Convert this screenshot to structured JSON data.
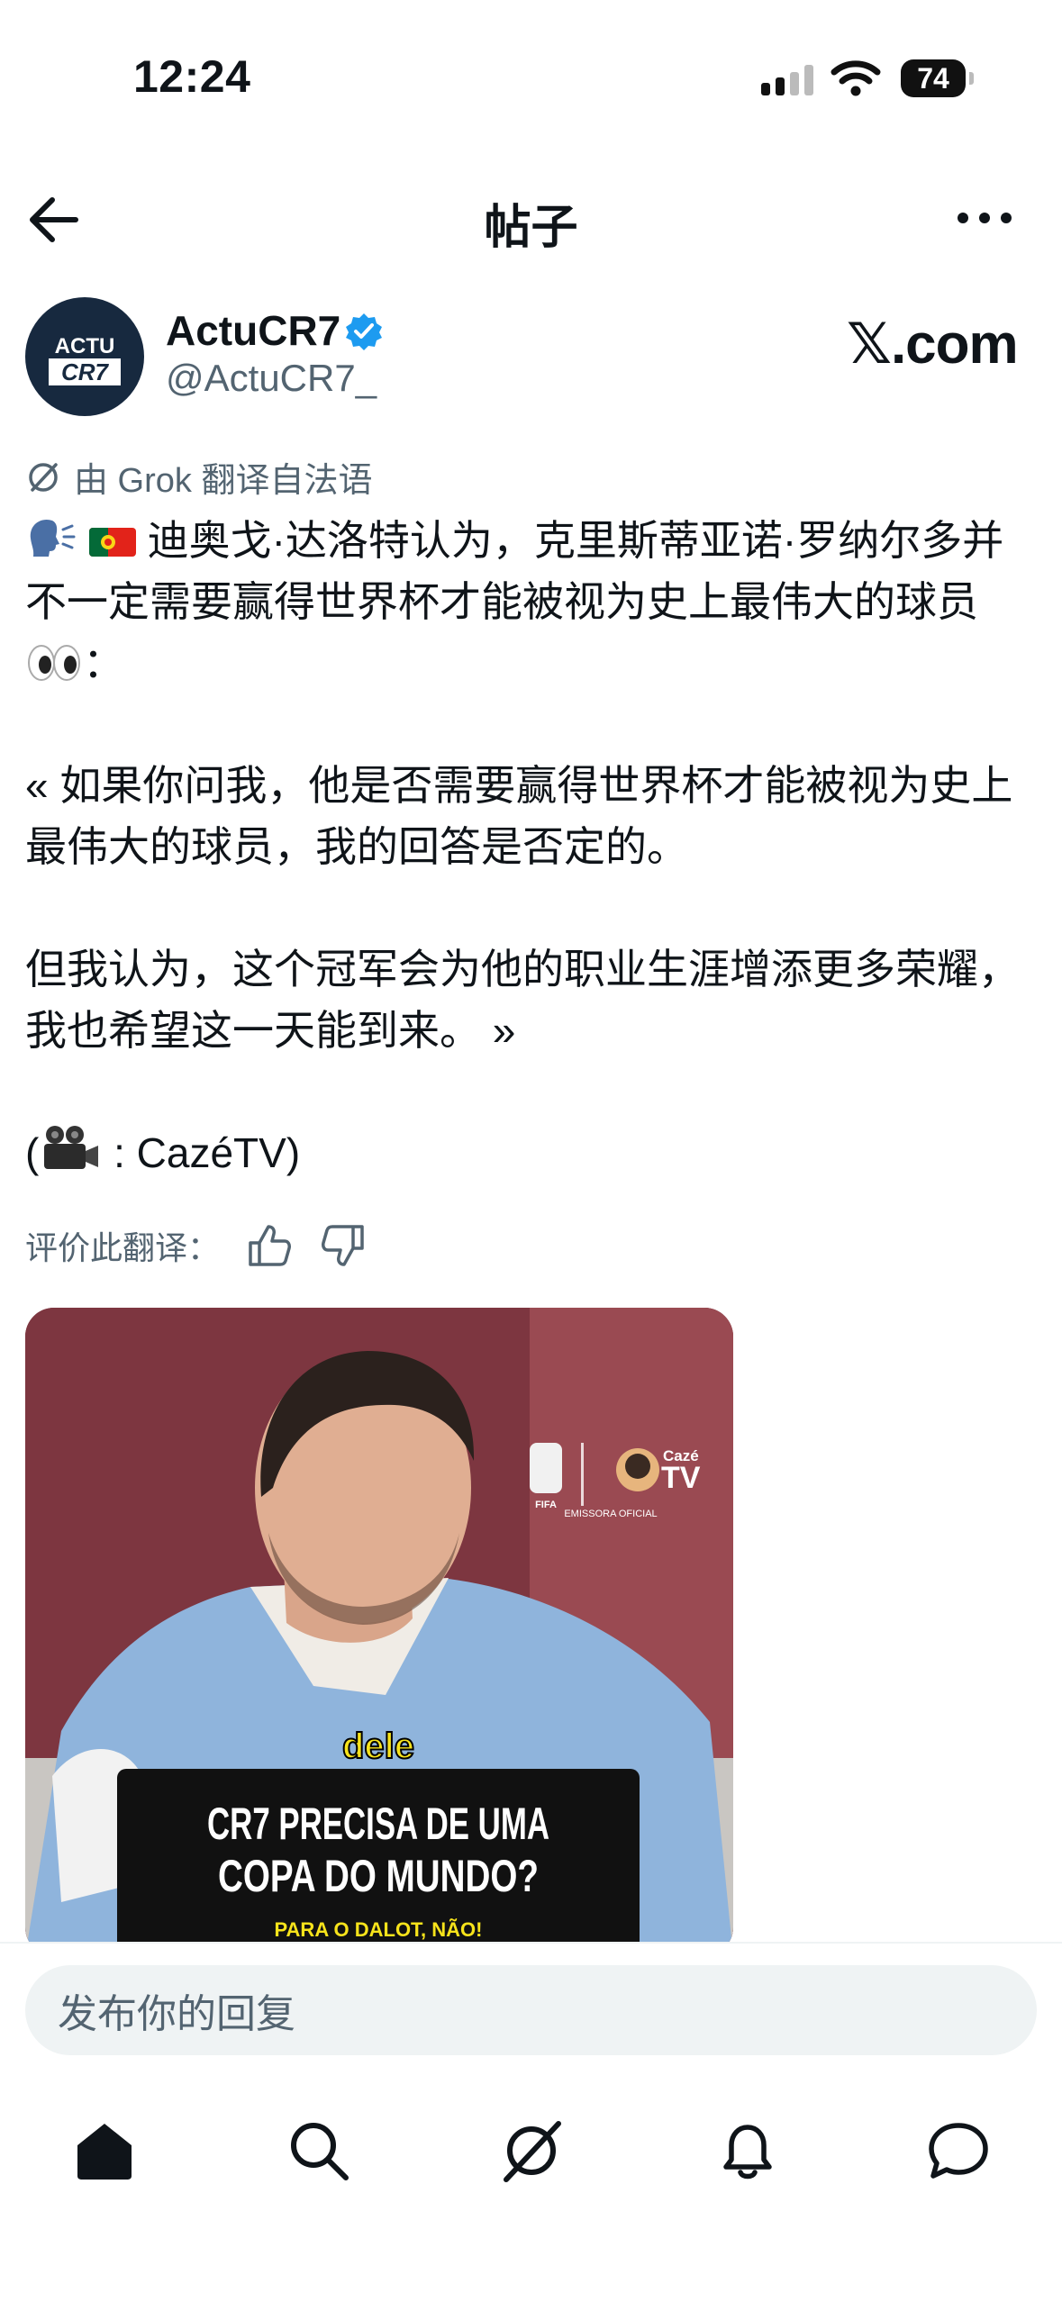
{
  "status": {
    "time": "12:24",
    "battery": "74"
  },
  "header": {
    "title": "帖子"
  },
  "author": {
    "name": "ActuCR7",
    "handle": "@ActuCR7_",
    "avatar_text_top": "ACTU",
    "avatar_text_bottom": "CR7"
  },
  "watermark": "𝕏.com",
  "translation_note": "由 Grok 翻译自法语",
  "post": {
    "line1_text": "迪奥戈·达洛特认为，克里斯蒂亚诺·罗纳尔多并不一定需要赢得世界杯才能被视为史上最伟大的球员",
    "line1_suffix": "：",
    "quote1": "« 如果你问我，他是否需要赢得世界杯才能被视为史上最伟大的球员，我的回答是否定的。",
    "quote2": "但我认为，这个冠军会为他的职业生涯增添更多荣耀，我也希望这一天能到来。 »",
    "credit_open": "(",
    "credit_text": " : CazéTV)"
  },
  "rate_translation": "评价此翻译：",
  "media": {
    "caption_word": "dele",
    "headline_line1": "CR7 PRECISA DE UMA",
    "headline_line2": "COPA DO MUNDO?",
    "subline": "PARA O DALOT, NÃO!",
    "broadcaster_label": "EMISSORA OFICIAL",
    "logo_text": "Cazé",
    "logo_text2": "TV",
    "fifa_text": "FIFA"
  },
  "reply": {
    "placeholder": "发布你的回复"
  },
  "nav": [
    "home-icon",
    "search-icon",
    "grok-icon",
    "notifications-icon",
    "messages-icon"
  ],
  "colors": {
    "verified": "#1d9bf0",
    "secondary_text": "#536471",
    "reply_bg": "#eff3f4"
  }
}
